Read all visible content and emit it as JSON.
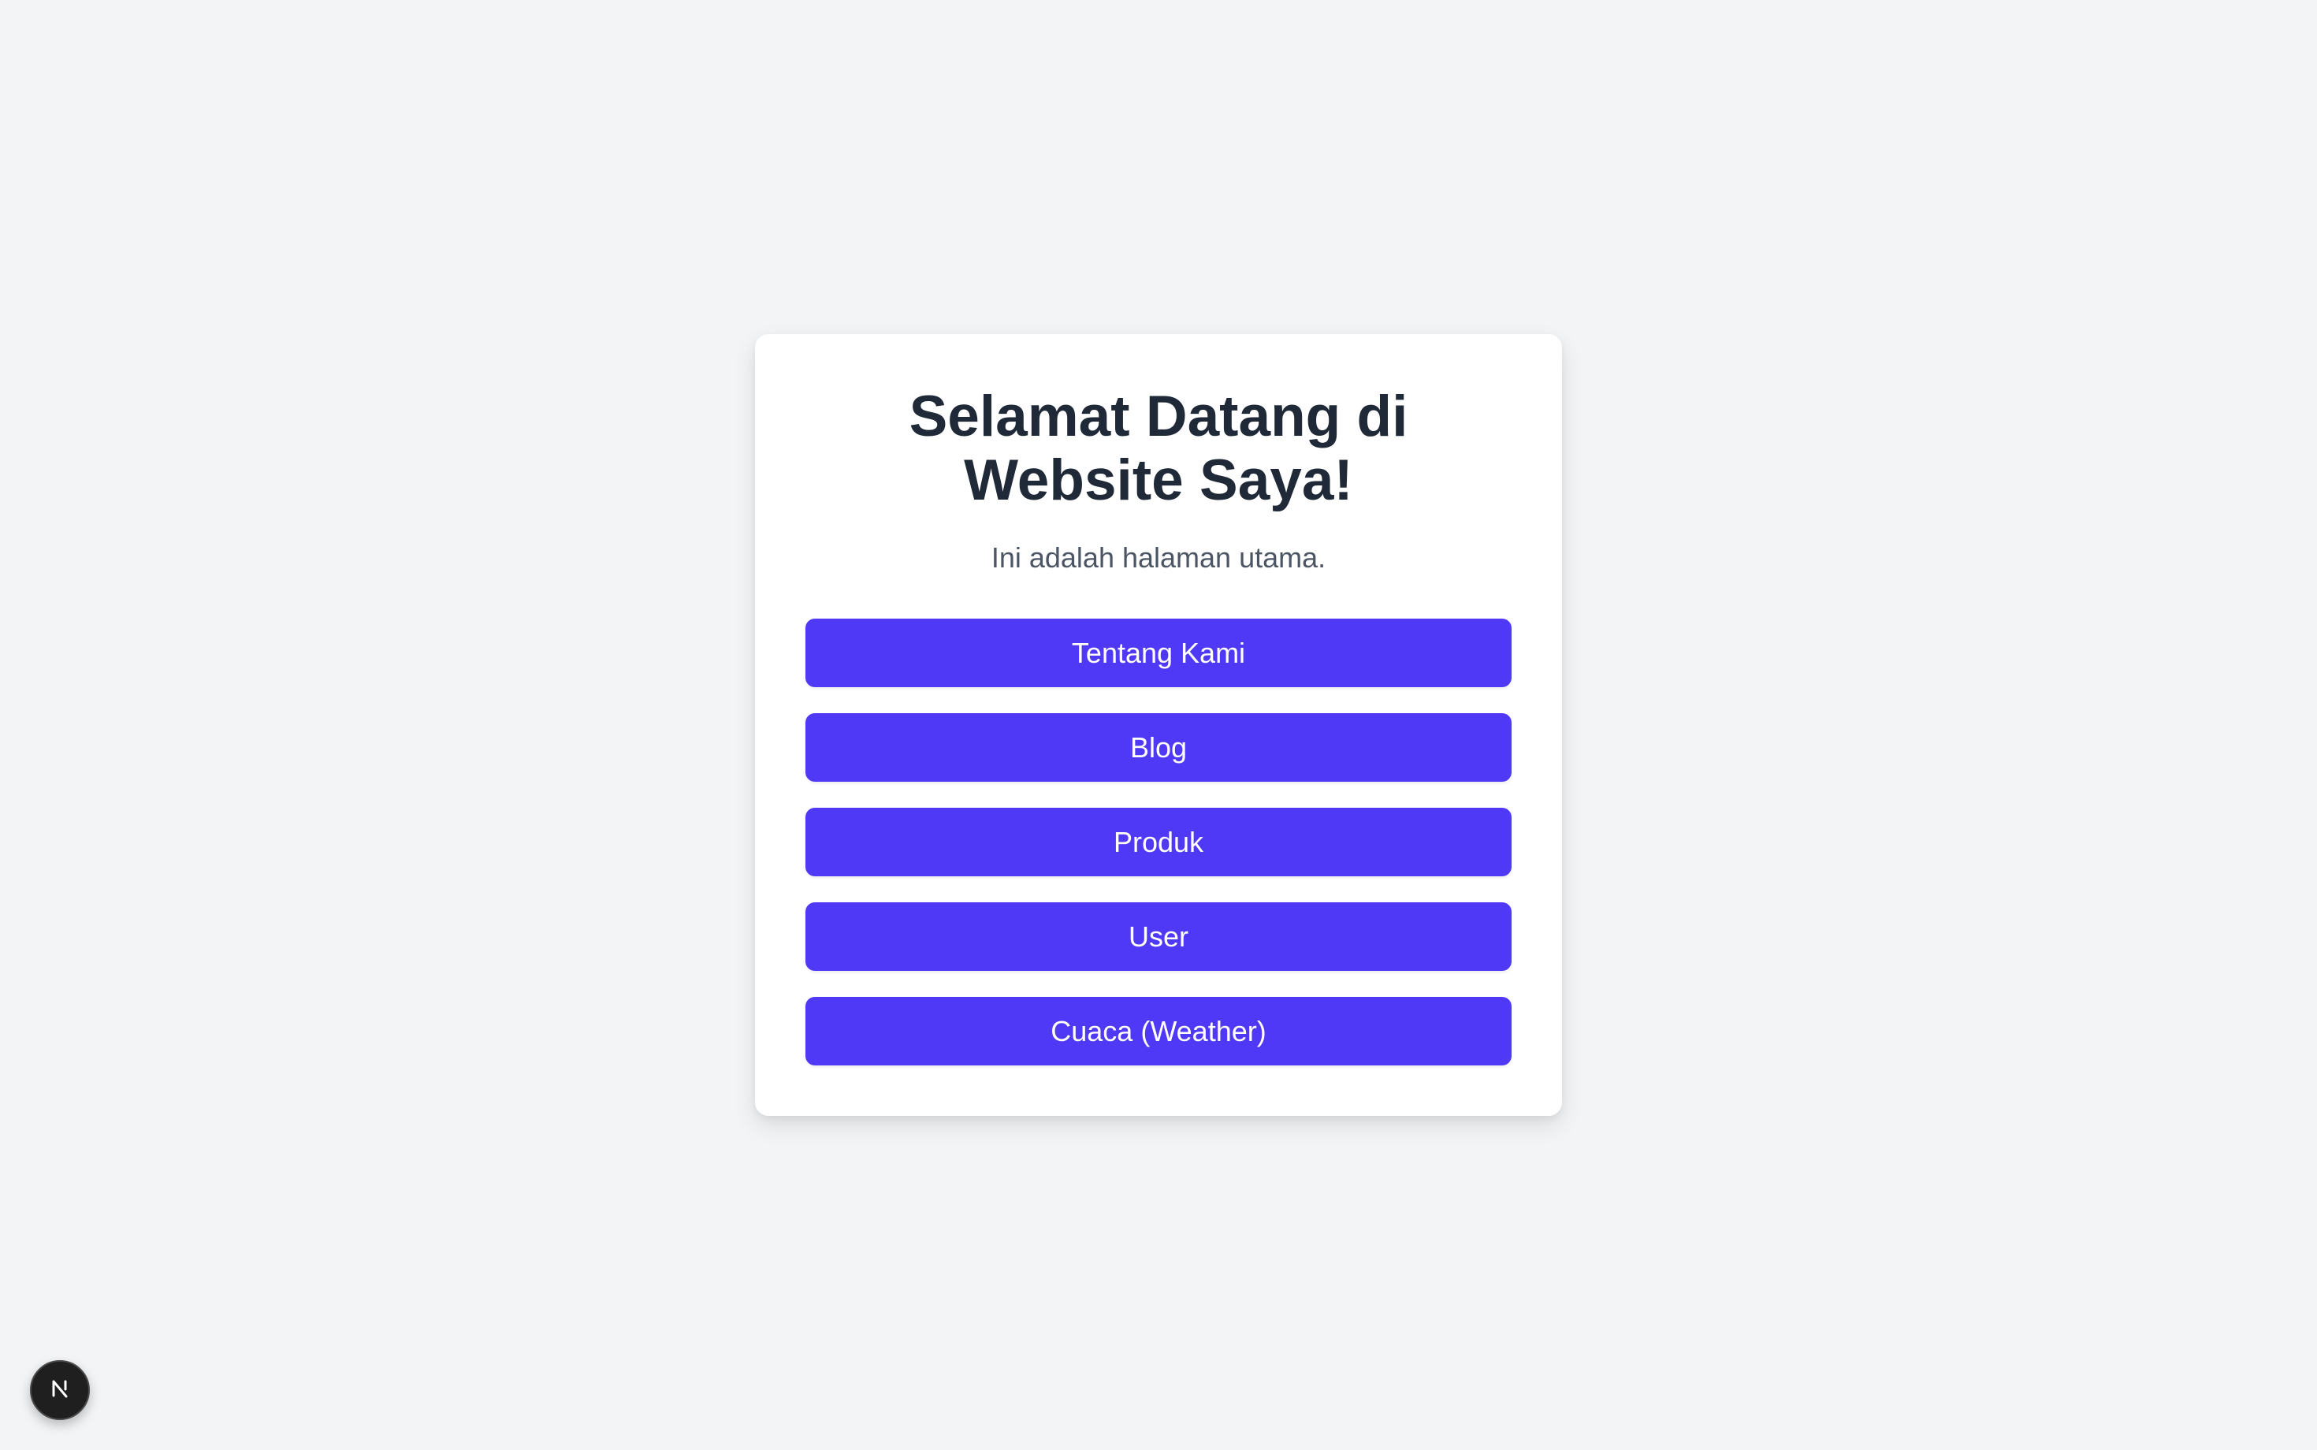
{
  "card": {
    "title": "Selamat Datang di Website Saya!",
    "subtitle": "Ini adalah halaman utama."
  },
  "buttons": [
    {
      "label": "Tentang Kami"
    },
    {
      "label": "Blog"
    },
    {
      "label": "Produk"
    },
    {
      "label": "User"
    },
    {
      "label": "Cuaca (Weather)"
    }
  ],
  "colors": {
    "page_background": "#f3f4f6",
    "card_background": "#ffffff",
    "button_background": "#4f39f6",
    "title": "#1f2937",
    "subtitle": "#4b5563"
  },
  "dev_badge": {
    "icon": "nextjs-logo-icon"
  }
}
